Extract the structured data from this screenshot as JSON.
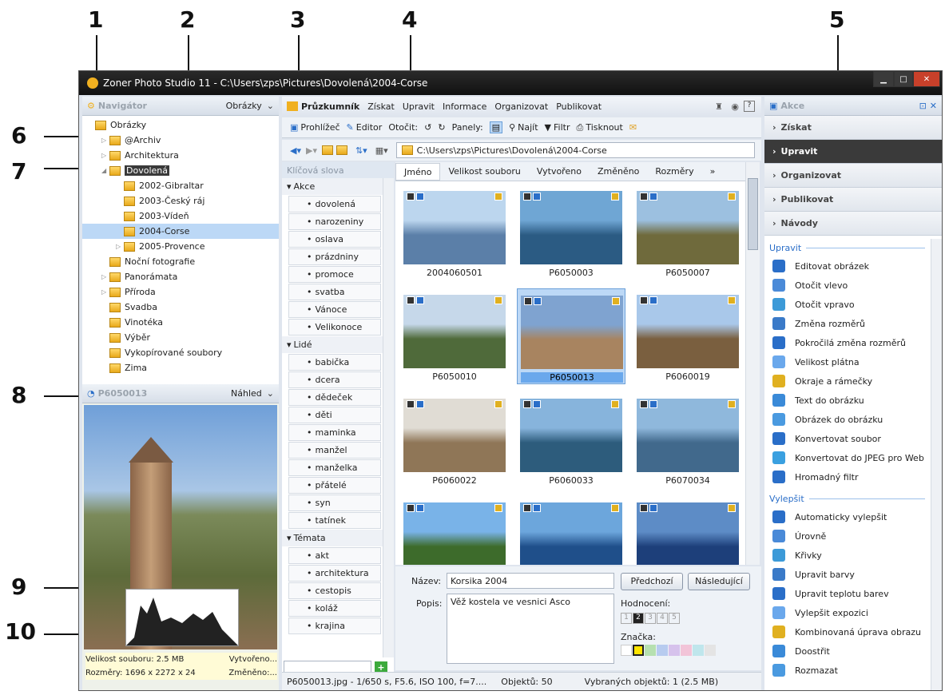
{
  "callouts": [
    "1",
    "2",
    "3",
    "4",
    "5",
    "6",
    "7",
    "8",
    "9",
    "10"
  ],
  "window": {
    "title": "Zoner Photo Studio 11 - C:\\Users\\zps\\Pictures\\Dovolená\\2004-Corse"
  },
  "navigator": {
    "title": "Navigátor",
    "mode": "Obrázky",
    "items": [
      {
        "label": "Obrázky",
        "indent": 0,
        "tri": ""
      },
      {
        "label": "@Archiv",
        "indent": 1,
        "tri": "▷"
      },
      {
        "label": "Architektura",
        "indent": 1,
        "tri": "▷"
      },
      {
        "label": "Dovolená",
        "indent": 1,
        "tri": "◢",
        "selected": true
      },
      {
        "label": "2002-Gibraltar",
        "indent": 2,
        "tri": ""
      },
      {
        "label": "2003-Český ráj",
        "indent": 2,
        "tri": ""
      },
      {
        "label": "2003-Vídeň",
        "indent": 2,
        "tri": ""
      },
      {
        "label": "2004-Corse",
        "indent": 2,
        "tri": "",
        "active": true
      },
      {
        "label": "2005-Provence",
        "indent": 2,
        "tri": "▷"
      },
      {
        "label": "Noční fotografie",
        "indent": 1,
        "tri": ""
      },
      {
        "label": "Panorámata",
        "indent": 1,
        "tri": "▷"
      },
      {
        "label": "Příroda",
        "indent": 1,
        "tri": "▷"
      },
      {
        "label": "Svadba",
        "indent": 1,
        "tri": ""
      },
      {
        "label": "Vinotéka",
        "indent": 1,
        "tri": ""
      },
      {
        "label": "Výběr",
        "indent": 1,
        "tri": ""
      },
      {
        "label": "Vykopírované soubory",
        "indent": 1,
        "tri": ""
      },
      {
        "label": "Zima",
        "indent": 1,
        "tri": ""
      }
    ]
  },
  "preview": {
    "title": "P6050013",
    "mode": "Náhled",
    "size": "Velikost souboru: 2.5 MB",
    "created": "Vytvořeno...",
    "dims": "Rozměry: 1696 x 2272 x 24",
    "changed": "Změněno:..."
  },
  "menu": {
    "items": [
      "Průzkumník",
      "Získat",
      "Upravit",
      "Informace",
      "Organizovat",
      "Publikovat"
    ]
  },
  "toolbar1": {
    "viewer": "Prohlížeč",
    "editor": "Editor",
    "rotate": "Otočit:",
    "panels": "Panely:",
    "find": "Najít",
    "filter": "Filtr",
    "print": "Tisknout"
  },
  "path": "C:\\Users\\zps\\Pictures\\Dovolená\\2004-Corse",
  "keywords": {
    "title": "Klíčová slova",
    "groups": [
      {
        "name": "Akce",
        "items": [
          "dovolená",
          "narozeniny",
          "oslava",
          "prázdniny",
          "promoce",
          "svatba",
          "Vánoce",
          "Velikonoce"
        ]
      },
      {
        "name": "Lidé",
        "items": [
          "babička",
          "dcera",
          "dědeček",
          "děti",
          "maminka",
          "manžel",
          "manželka",
          "přátelé",
          "syn",
          "tatínek"
        ]
      },
      {
        "name": "Témata",
        "items": [
          "akt",
          "architektura",
          "cestopis",
          "koláž",
          "krajina"
        ]
      }
    ]
  },
  "columns": [
    "Jméno",
    "Velikost souboru",
    "Vytvořeno",
    "Změněno",
    "Rozměry",
    "»"
  ],
  "thumbs": [
    {
      "name": "2004060501",
      "c1": "#bcd6ee",
      "c2": "#5b7fa8"
    },
    {
      "name": "P6050003",
      "c1": "#6fa6d4",
      "c2": "#2b5b83"
    },
    {
      "name": "P6050007",
      "c1": "#9cc0e0",
      "c2": "#6f6a3c"
    },
    {
      "name": "P6050010",
      "c1": "#c6d8ea",
      "c2": "#4f6a3a"
    },
    {
      "name": "P6050013",
      "c1": "#7fa3d0",
      "c2": "#a88460",
      "selected": true
    },
    {
      "name": "P6060019",
      "c1": "#a9c8ea",
      "c2": "#7a5f3f"
    },
    {
      "name": "P6060022",
      "c1": "#e0dcd4",
      "c2": "#8f7657"
    },
    {
      "name": "P6060033",
      "c1": "#87b4dc",
      "c2": "#2d5c7c"
    },
    {
      "name": "P6070034",
      "c1": "#8fb8dc",
      "c2": "#41698c"
    },
    {
      "name": "",
      "c1": "#79b3e8",
      "c2": "#3d6b2b"
    },
    {
      "name": "",
      "c1": "#6ca6dc",
      "c2": "#1f4f8a"
    },
    {
      "name": "",
      "c1": "#5d8cc6",
      "c2": "#1d3f7a"
    }
  ],
  "details": {
    "name_label": "Název:",
    "name_value": "Korsika 2004",
    "desc_label": "Popis:",
    "desc_value": "Věž kostela ve vesnici Asco",
    "prev": "Předchozí",
    "next": "Následující",
    "rating": "Hodnocení:",
    "mark": "Značka:",
    "stars": [
      "1",
      "2",
      "3",
      "4",
      "5"
    ]
  },
  "statusbar": {
    "file": "P6050013.jpg - 1/650 s, F5.6, ISO 100, f=7....",
    "count": "Objektů: 50",
    "selected": "Vybraných objektů: 1 (2.5 MB)"
  },
  "actions": {
    "title": "Akce",
    "sections": [
      "Získat",
      "Upravit",
      "Organizovat",
      "Publikovat",
      "Návody"
    ],
    "edit_title": "Upravit",
    "edit": [
      "Editovat obrázek",
      "Otočit vlevo",
      "Otočit vpravo",
      "Změna rozměrů",
      "Pokročilá změna rozměrů",
      "Velikost plátna",
      "Okraje a rámečky",
      "Text do obrázku",
      "Obrázek do obrázku",
      "Konvertovat soubor",
      "Konvertovat do JPEG pro Web",
      "Hromadný filtr"
    ],
    "improve_title": "Vylepšit",
    "improve": [
      "Automaticky vylepšit",
      "Úrovně",
      "Křivky",
      "Upravit barvy",
      "Upravit teplotu barev",
      "Vylepšit expozici",
      "Kombinovaná úprava obrazu",
      "Doostřit",
      "Rozmazat"
    ]
  },
  "colors": {
    "accent": "#2a6ec8",
    "selected": "#bcd8f6",
    "selbar": "#3a3a3a"
  }
}
